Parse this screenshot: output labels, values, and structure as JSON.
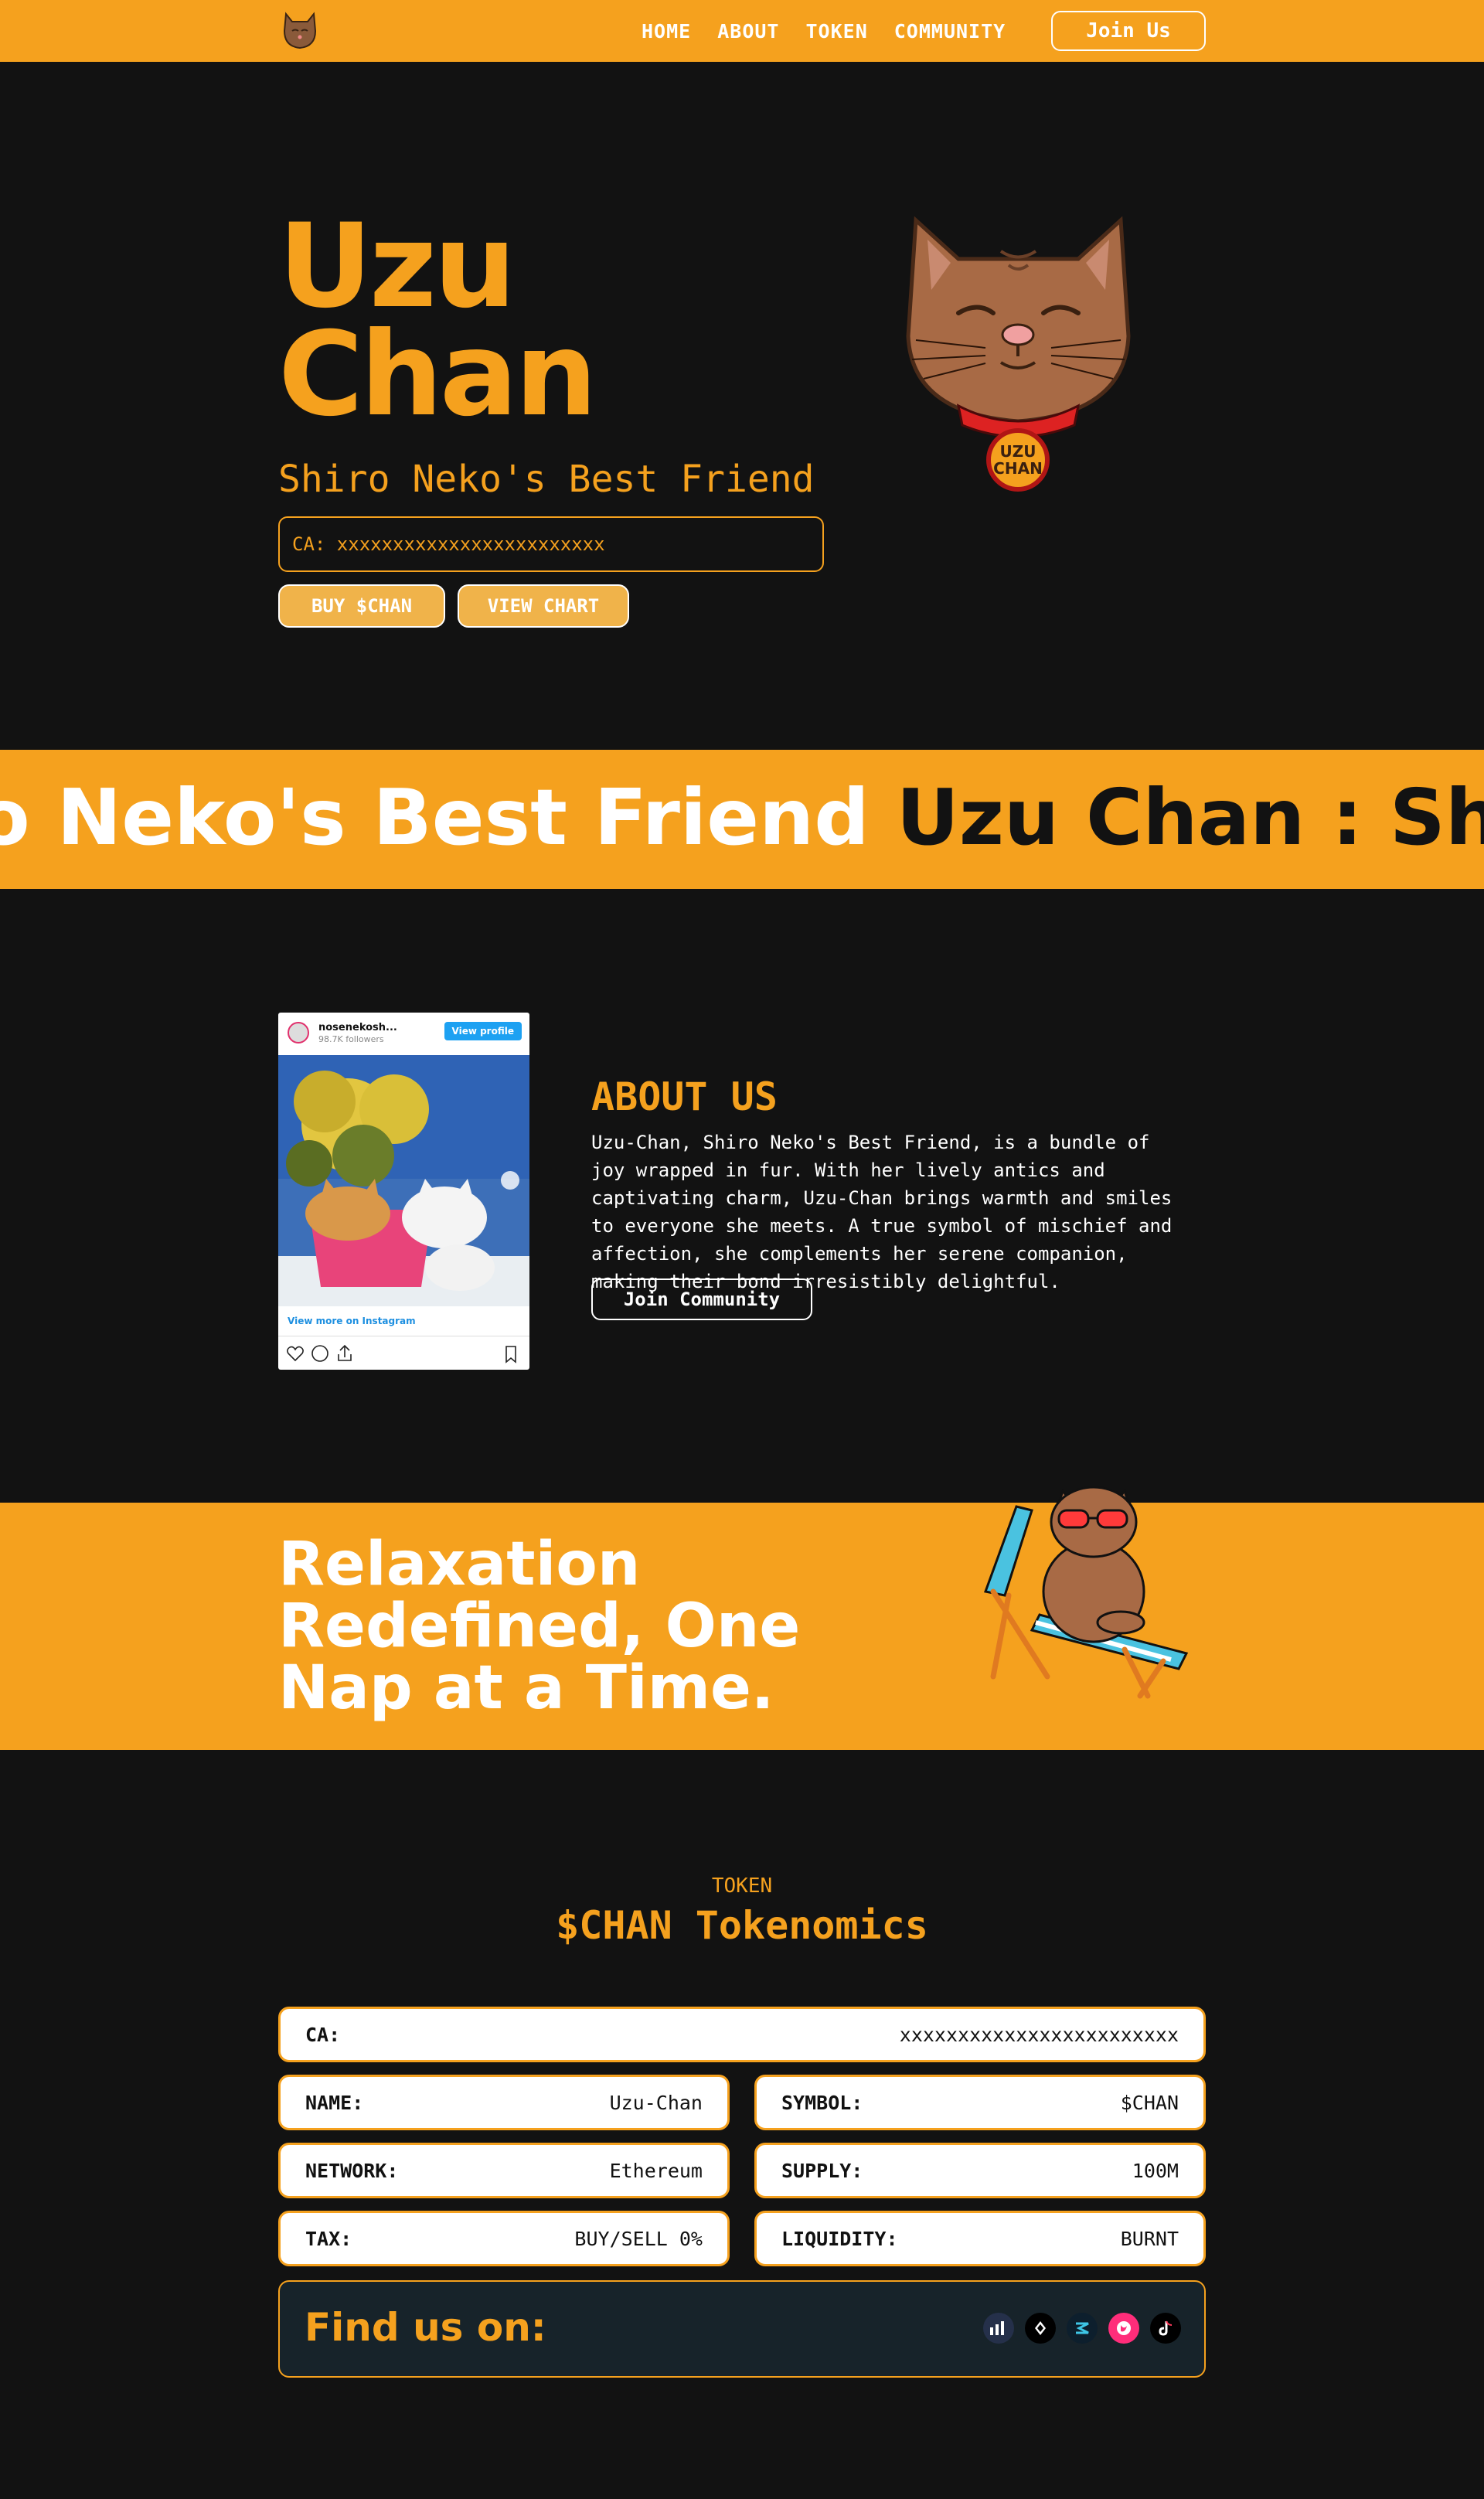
{
  "nav": {
    "items": [
      "Home",
      "About",
      "Token",
      "Community"
    ],
    "join_label": "Join Us"
  },
  "hero": {
    "title_line1": "Uzu",
    "title_line2": "Chan",
    "subtitle": "Shiro Neko's Best Friend",
    "ca": "CA: xxxxxxxxxxxxxxxxxxxxxxxx",
    "buy_label": "BUY $CHAN",
    "chart_label": "VIEW CHART",
    "collar_text_1": "UZU",
    "collar_text_2": "CHAN"
  },
  "marquee": {
    "white_text": "o Neko's Best Friend",
    "dark_text": "Uzu Chan : Shiro Nek"
  },
  "instagram": {
    "username": "nosenekosh...",
    "followers": "98.7K followers",
    "view_profile": "View profile",
    "view_more": "View more on Instagram"
  },
  "about": {
    "heading": "ABOUT US",
    "paragraph": "Uzu-Chan, Shiro Neko's Best Friend, is a bundle of joy wrapped in fur. With her lively antics and captivating charm, Uzu-Chan brings warmth and smiles to everyone she meets. A true symbol of mischief and affection, she complements her serene companion, making their bond irresistibly delightful.",
    "button": "Join Community"
  },
  "relax": {
    "text": "Relaxation Redefined, One Nap at a Time."
  },
  "tokenomics": {
    "small": "TOKEN",
    "title": "$CHAN Tokenomics",
    "ca_label": "CA:",
    "ca_value": "xxxxxxxxxxxxxxxxxxxxxxxx",
    "name_label": "NAME:",
    "name_value": "Uzu-Chan",
    "symbol_label": "SYMBOL:",
    "symbol_value": "$CHAN",
    "network_label": "NETWORK:",
    "network_value": "Ethereum",
    "supply_label": "SUPPLY:",
    "supply_value": "100M",
    "tax_label": "TAX:",
    "tax_value": "BUY/SELL 0%",
    "liquidity_label": "LIQUIDITY:",
    "liquidity_value": "BURNT",
    "find_label": "Find us on:"
  },
  "socials": [
    {
      "name": "dextools-icon",
      "color": "#25304a"
    },
    {
      "name": "etherscan-icon",
      "color": "#000000"
    },
    {
      "name": "dexscreener-icon",
      "color": "#0d1f2d"
    },
    {
      "name": "uniswap-icon",
      "color": "#ff2d7a"
    },
    {
      "name": "tiktok-icon",
      "color": "#000000"
    }
  ],
  "colors": {
    "accent": "#f5a11e",
    "background": "#121212",
    "find_bg": "#17232a"
  }
}
